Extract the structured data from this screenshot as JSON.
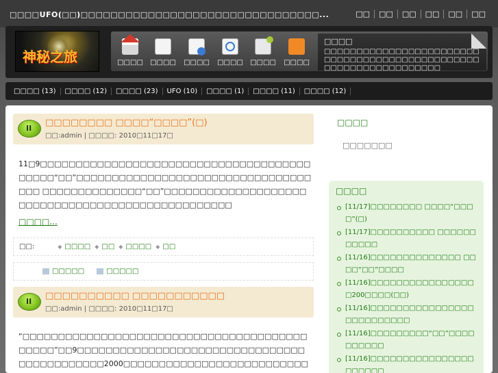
{
  "top": {
    "site_title": "□□□□UFO(□□)□□□□□□□□□□□□□□□□□□□□□□□□□□□□□□□□...",
    "links": [
      "□□",
      "□□",
      "□□",
      "□□",
      "□□",
      "□□"
    ]
  },
  "header": {
    "logo_text": "神秘之旅",
    "nav": [
      {
        "label": "□□□□",
        "icon": "home-icon"
      },
      {
        "label": "□□□□",
        "icon": "document-icon"
      },
      {
        "label": "□□□□",
        "icon": "page-icon"
      },
      {
        "label": "□□□□",
        "icon": "search-icon"
      },
      {
        "label": "□□□□",
        "icon": "mail-icon"
      },
      {
        "label": "□□□□",
        "icon": "rss-icon"
      }
    ],
    "notice_title": "□□□□",
    "notice_text": "□□□□□□□□□□□□□□□□□□□□□□□□□□□□□□□□□□□□□□□□□□□□□□□□□□□□□□□□□□□□□□□□□□"
  },
  "categories": [
    "□□□□ (13)",
    "□□□□ (12)",
    "□□□□ (23)",
    "UFO (10)",
    "□□□□ (1)",
    "□□□□ (11)",
    "□□□□ (12)"
  ],
  "posts": [
    {
      "title": "□□□□□□□□ □□□□“□□□□”(□)",
      "meta": "□□:admin | □□□□: 2010□11□17□",
      "body": "11□9□□□□□□□□□□□□□□□□□□□□□□□□□□□□□□□□□□□□□□□□□□□“□□”□□□□□□□□□□□□□□□□□□□□□□□□□□□□□□□□□□□□ □□□□□□□□□□□□□□“□□”□□□□□□□□□□□□□□□□□□□□□□□□□□□□□□□□□□□□□□□□□□□□□□□□□□",
      "read_more": "□□□□...",
      "tags_label": "□□:",
      "tags": [
        "□□□□",
        "□□",
        "□□□□",
        "□□"
      ],
      "links": [
        "□□□□□",
        "□□□□□"
      ]
    },
    {
      "title": "□□□□□□□□□□ □□□□□□□□□□□",
      "meta": "□□:admin | □□□□: 2010□11□17□",
      "body": "“□□□□□□□□□□□□□□□□□□□□□□□□□□□□□□□□□□□□□□□□□□□□□”□□9□□□□□□□□□□□□□□□□□□□□□□□□□□□□□□□□□□□□□□□□□□□□2000□□□□□□□□□□□□□□□□□□□□□□□□□□□□□□□□□□□□□□□"
    }
  ],
  "sidebar": {
    "title1": "□□□□",
    "text1": "□□□□□□□",
    "recent_title": "□□□□",
    "recent": [
      "[11/17]□□□□□□□□ □□□□“□□□□”(□)",
      "[11/17]□□□□□□□□□□ □□□□□□□□□□□",
      "[11/16]□□□□□□□□□□□□□□ □□□□“□□”□□□□",
      "[11/16]□□□□□□□□□□□□□□□□□200□□□□(□□)",
      "[11/16]□□□□□□□□□□□□□□□□□□□□□□□□□□",
      "[11/16]□□□□□□□□□“□□”□□□□□□□□□□",
      "[11/16]□□□□□□□□□□□□□□□□□□□□□□"
    ]
  }
}
